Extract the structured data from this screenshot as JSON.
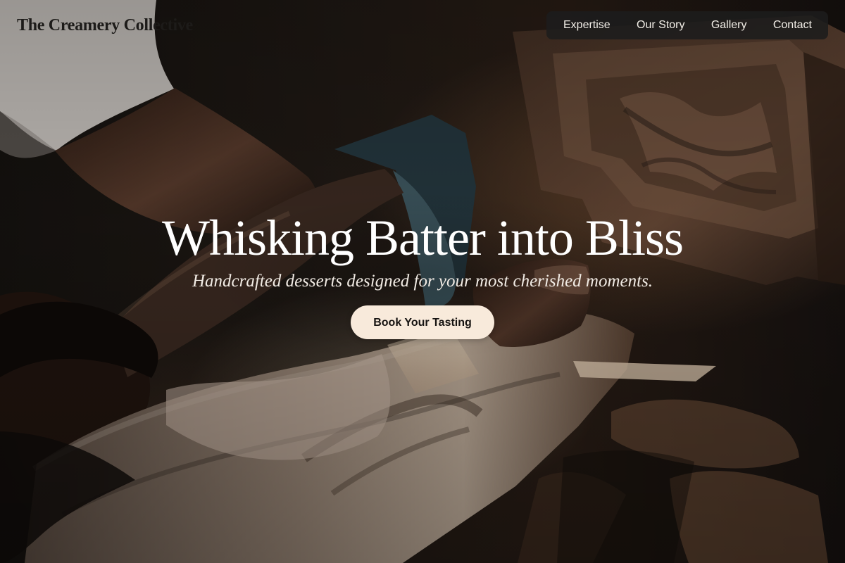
{
  "brand": {
    "logo_text": "The Creamery Collective"
  },
  "nav": {
    "items": [
      {
        "label": "Expertise"
      },
      {
        "label": "Our Story"
      },
      {
        "label": "Gallery"
      },
      {
        "label": "Contact"
      }
    ]
  },
  "hero": {
    "title": "Whisking Batter into Bliss",
    "subtitle": "Handcrafted desserts designed for your most cherished moments.",
    "cta_label": "Book Your Tasting"
  },
  "colors": {
    "text_primary": "#ffffff",
    "text_muted": "#f1ebe4",
    "button_background": "#f8eadb",
    "nav_background": "#1c1c1c",
    "logo_color": "#1d1b19"
  }
}
